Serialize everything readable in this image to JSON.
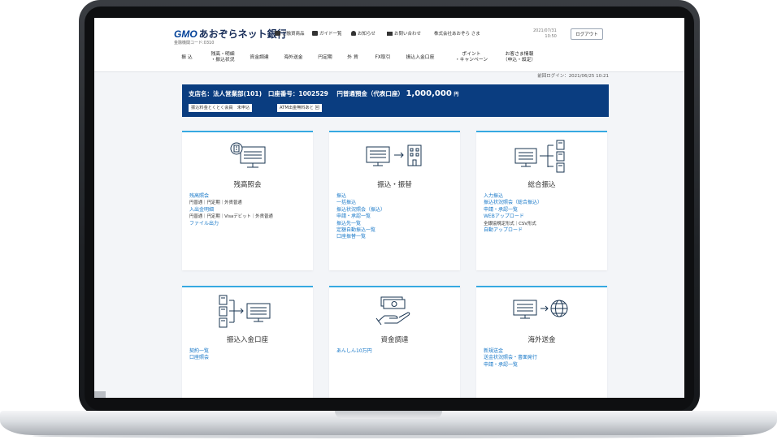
{
  "header": {
    "logo_brand": "GMO",
    "logo_text": "あおぞらネット銀行",
    "bank_code": "金融機関コード:0310",
    "utility": [
      "ご融資商品",
      "ガイド一覧",
      "お知らせ",
      "お問い合わせ"
    ],
    "user_name": "株式会社あおぞら さま",
    "date": "2021/07/31",
    "time": "10:50",
    "logout_label": "ログアウト"
  },
  "nav": [
    "振 込",
    "残高・明細\n・振込状況",
    "資金調達",
    "海外送金",
    "円定期",
    "外 貨",
    "FX取引",
    "振込入金口座",
    "ポイント\n・キャンペーン",
    "お客さま情報\n（申込・設定）"
  ],
  "last_login": "前回ログイン：2021/06/25 10:21",
  "account": {
    "branch_label": "支店名：法人営業部(101)",
    "number_label": "口座番号：1002529",
    "balance_label": "円普通預金（代表口座）",
    "balance_value": "1,000,000",
    "balance_unit": "円",
    "tags": [
      "振込料金とくとく会員　未申込",
      "ATM出金無料あと 回"
    ]
  },
  "cards": [
    {
      "title": "残高照会",
      "icon": "monitor-building-icon",
      "items": [
        {
          "type": "link",
          "text": "残高照会"
        },
        {
          "type": "sub",
          "text": "円普通｜円定期｜外貨普通"
        },
        {
          "type": "link",
          "text": "入出金明細"
        },
        {
          "type": "sub",
          "text": "円普通｜円定期｜Visaデビット｜外貨普通"
        },
        {
          "type": "link",
          "text": "ファイル出力"
        }
      ]
    },
    {
      "title": "振込・振替",
      "icon": "monitor-arrow-building-icon",
      "items": [
        {
          "type": "link",
          "text": "振込"
        },
        {
          "type": "link",
          "text": "一括振込"
        },
        {
          "type": "link",
          "text": "振込状況照会（振込）"
        },
        {
          "type": "link",
          "text": "申請・承認一覧"
        },
        {
          "type": "link",
          "text": "振込先一覧"
        },
        {
          "type": "link",
          "text": "定額自動振込一覧"
        },
        {
          "type": "link",
          "text": "口座振替一覧"
        }
      ]
    },
    {
      "title": "総合振込",
      "icon": "monitor-multi-building-icon",
      "items": [
        {
          "type": "link",
          "text": "入力振込"
        },
        {
          "type": "link",
          "text": "振込状況照会（総合振込）"
        },
        {
          "type": "link",
          "text": "申請・承認一覧"
        },
        {
          "type": "link",
          "text": "WEBアップロード"
        },
        {
          "type": "sub",
          "text": "全銀協規定形式｜CSV形式"
        },
        {
          "type": "link",
          "text": "自動アップロード"
        }
      ]
    },
    {
      "title": "振込入金口座",
      "icon": "buildings-arrow-monitor-icon",
      "items": [
        {
          "type": "link",
          "text": "契約一覧"
        },
        {
          "type": "link",
          "text": "口座照会"
        }
      ]
    },
    {
      "title": "資金調達",
      "icon": "money-hand-icon",
      "items": [
        {
          "type": "link",
          "text": "あんしん10万円"
        }
      ]
    },
    {
      "title": "海外送金",
      "icon": "monitor-globe-icon",
      "items": [
        {
          "type": "link",
          "text": "新規送金"
        },
        {
          "type": "link",
          "text": "送金状況照会・書面発行"
        },
        {
          "type": "link",
          "text": "申請・承認一覧"
        }
      ]
    }
  ],
  "colors": {
    "accent": "#36a9e1",
    "banner": "#0a3d80",
    "link": "#1878c8"
  }
}
